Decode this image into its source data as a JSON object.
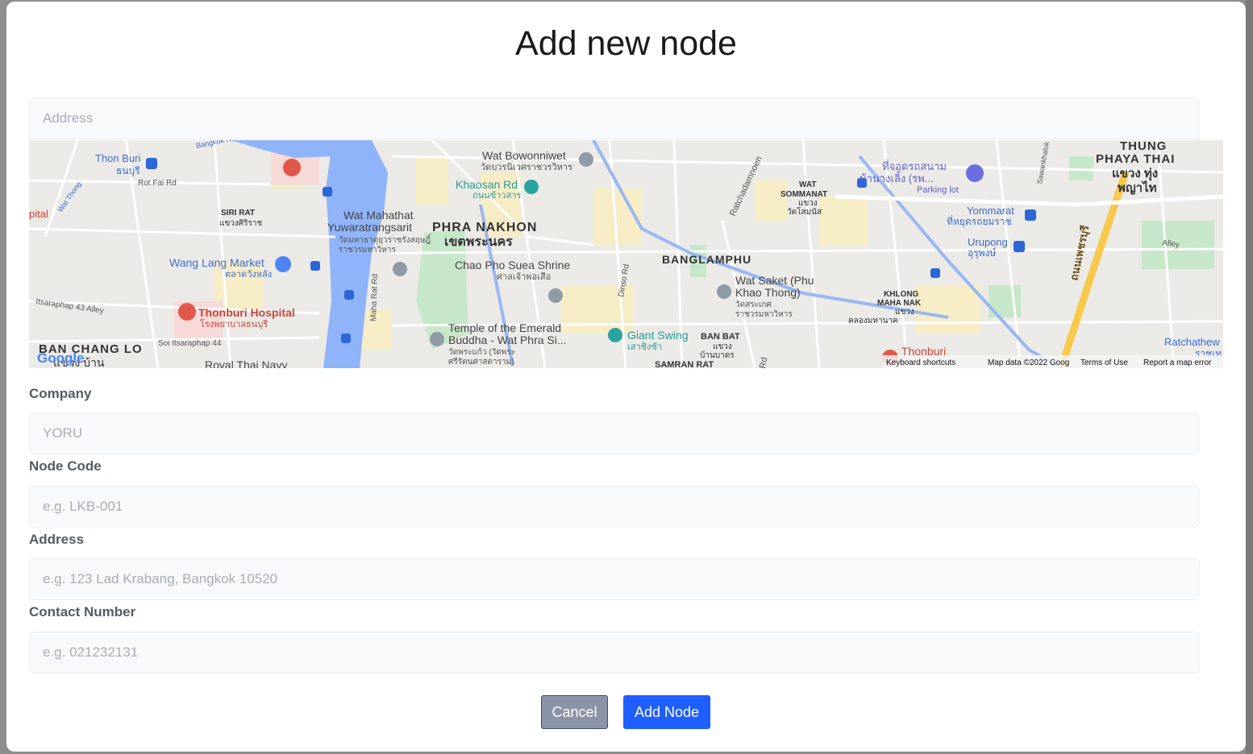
{
  "modal": {
    "title": "Add new node"
  },
  "search": {
    "placeholder": "Address"
  },
  "map": {
    "places": {
      "thon_buri": "Thon Buri",
      "thon_buri_th": "ธนบุรี",
      "rot_fai_rd": "Rot Fai Rd",
      "hospital_partial": "pital",
      "siri_rat": "SIRI RAT",
      "siri_rat_th": "แขวงศิริราช",
      "wat_mahathat_1": "Wat Mahathat",
      "wat_mahathat_2": "Yuwaratrangsarit",
      "wat_mahathat_th_1": "วัดมหาธาตุยุวราชรังสฤษฎิ์",
      "wat_mahathat_th_2": "ราชวรมหาวิหาร",
      "phra_nakhon": "PHRA NAKHON",
      "phra_nakhon_th": "เขตพระนคร",
      "wat_bowonniwet": "Wat Bowonniwet",
      "wat_bowonniwet_th": "วัดบวรนิเวศราชวรวิหาร",
      "khaosan_rd": "Khaosan Rd",
      "khaosan_rd_th": "ถนนข้าวสาร",
      "chao_pho": "Chao Pho Suea Shrine",
      "chao_pho_th": "ศาลเจ้าพ่อเสือ",
      "wang_lang": "Wang Lang Market",
      "wang_lang_th": "ตลาดวังหลัง",
      "thonburi_hospital": "Thonburi Hospital",
      "thonburi_hospital_th": "โรงพยาบาลธนบุรี",
      "itsaraphap_43": "Itsaraphap 43 Alley",
      "soi_itsaraphap": "Soi Itsaraphap 44",
      "ban_chang_lo": "BAN CHANG LO",
      "ban_chang_lo_th": "แขวง บ้าน",
      "royal_thai_navy": "Royal Thai Navy",
      "temple_emerald_1": "Temple of the Emerald",
      "temple_emerald_2": "Buddha - Wat Phra Si...",
      "temple_emerald_th_1": "วัดพระแก้ว (วัดพระ",
      "temple_emerald_th_2": "ศรีรัตนศาสดาราม)",
      "giant_swing": "Giant Swing",
      "giant_swing_th": "เสาชิงช้า",
      "banglamphu": "BANGLAMPHU",
      "wat_saket_1": "Wat Saket (Phu",
      "wat_saket_2": "Khao Thong)",
      "wat_saket_th_1": "วัดสระเกศ",
      "wat_saket_th_2": "ราชวรมหาวิหาร",
      "ban_bat": "BAN BAT",
      "ban_bat_th_1": "แขวง",
      "ban_bat_th_2": "บ้านบาตร",
      "samran_rat": "SAMRAN RAT",
      "wat_sommanat_1": "WAT",
      "wat_sommanat_2": "SOMMANAT",
      "wat_sommanat_th_1": "แขวง",
      "wat_sommanat_th_2": "วัดโสมนัส",
      "parking_th_1": "ที่จอดรถสนาม",
      "parking_th_2": "ม้านางเลิ้ง (รพ...",
      "parking_lot": "Parking lot",
      "thung_1": "THUNG",
      "thung_2": "PHAYA THAI",
      "thung_th_1": "แขวง ทุ่ง",
      "thung_th_2": "พญาไท",
      "yommarat": "Yommarat",
      "yommarat_th": "ที่หยุดรถยมราช",
      "urupong": "Urupong",
      "urupong_th": "อุรุพงษ์",
      "khlong_1": "KHLONG",
      "khlong_2": "MAHA NAK",
      "khlong_th_1": "แขวง",
      "khlong_th_2": "คลองมหานาค",
      "thonburi_2": "Thonburi",
      "ratchathew": "Ratchathew",
      "ratchathew_th": "ราชเท",
      "alley": "Alley",
      "ratchadamnoen": "Ratchadamnoen",
      "dinso_rd": "Dinso Rd",
      "maha_rat_rd": "Maha Rat Rd",
      "sawankhalok": "Sawankhalok",
      "bangkok_noi": "Bangkok Noi",
      "wat_thong": "Wat Thong",
      "phetchaburi_th": "ถนนเพชรบุรี",
      "rd": "Rd"
    },
    "google_logo": "Google",
    "attribution": {
      "keyboard": "Keyboard shortcuts",
      "map_data": "Map data ©2022 Goog",
      "terms": "Terms of Use",
      "report": "Report a map error"
    }
  },
  "form": {
    "company": {
      "label": "Company",
      "placeholder": "YORU"
    },
    "node_code": {
      "label": "Node Code",
      "placeholder": "e.g. LKB-001"
    },
    "address": {
      "label": "Address",
      "placeholder": "e.g. 123 Lad Krabang, Bangkok 10520"
    },
    "contact": {
      "label": "Contact Number",
      "placeholder": "e.g. 021232131"
    }
  },
  "buttons": {
    "cancel": "Cancel",
    "add": "Add Node"
  },
  "colors": {
    "primary": "#1f5eff",
    "cancel": "#8b93a6",
    "water": "#8fb4f9",
    "park": "#c4e5c8",
    "road_major": "#f6c84b"
  }
}
